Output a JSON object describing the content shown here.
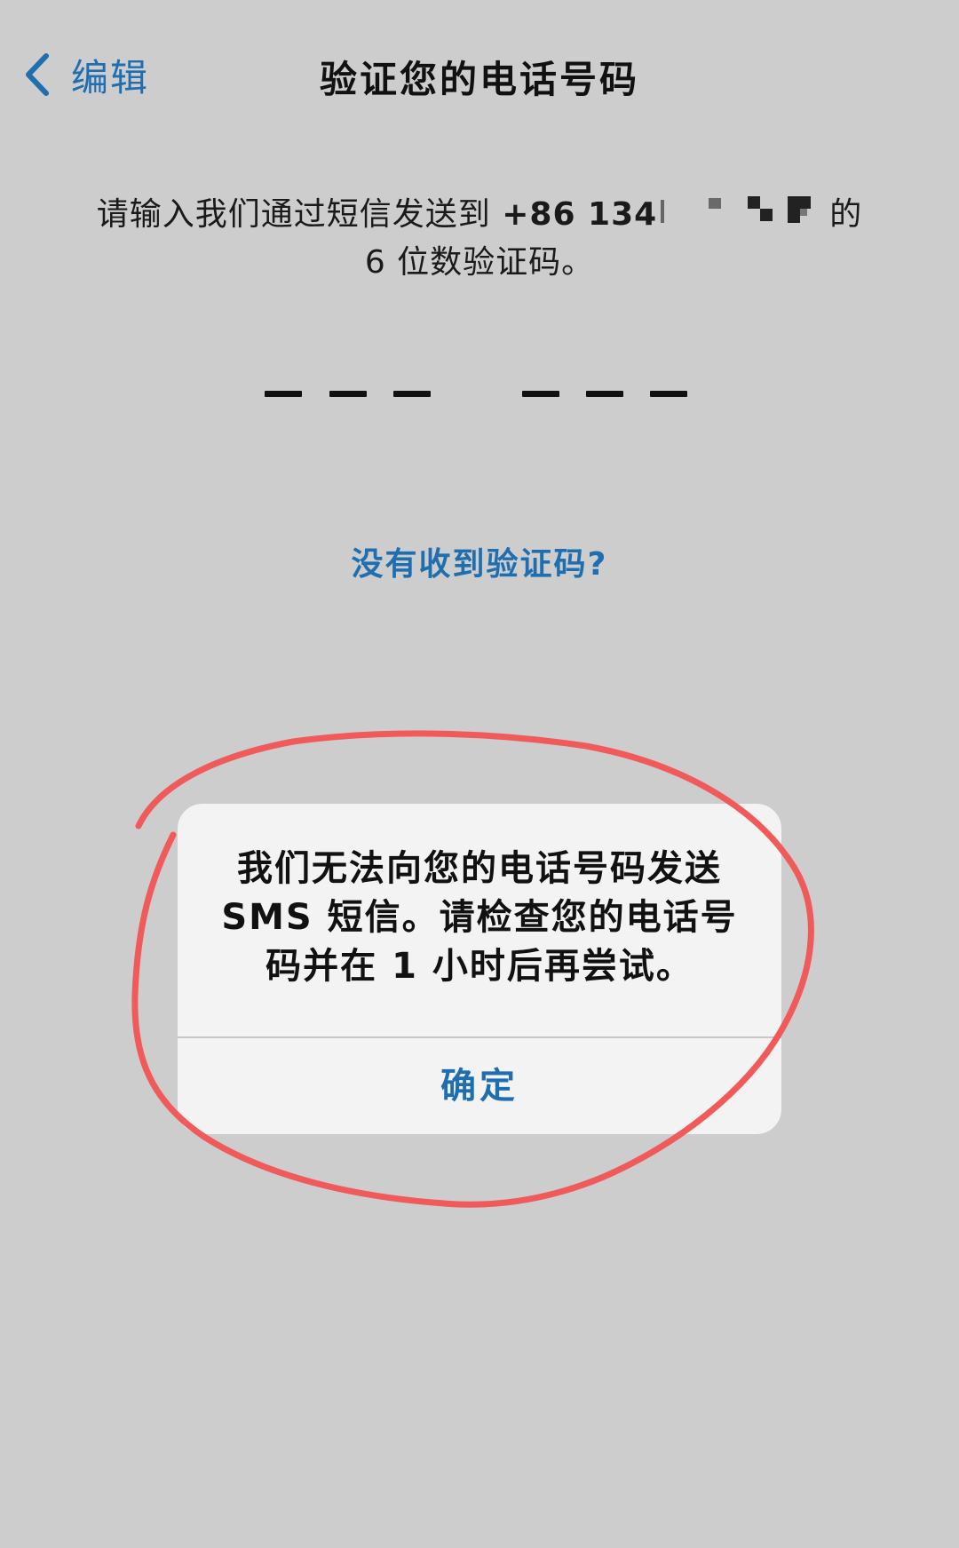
{
  "nav": {
    "back_label": "编辑",
    "title": "验证您的电话号码"
  },
  "instruction": {
    "prefix": "请输入我们通过短信发送到 ",
    "phone_visible": "+86 134",
    "suffix_line1": "的",
    "line2": "6 位数验证码。"
  },
  "code_entry": {
    "digits": [
      "",
      "",
      "",
      "",
      "",
      ""
    ]
  },
  "resend": {
    "label": "没有收到验证码?"
  },
  "alert": {
    "message": "我们无法向您的电话号码发送 SMS 短信。请检查您的电话号码并在 1 小时后再尝试。",
    "confirm_label": "确定"
  },
  "colors": {
    "background": "#cdcdcd",
    "link_blue": "#1f6fb0",
    "alert_bg": "#f3f3f3",
    "annotation_red": "#f05a5a"
  },
  "icons": {
    "back": "chevron-left-icon"
  }
}
